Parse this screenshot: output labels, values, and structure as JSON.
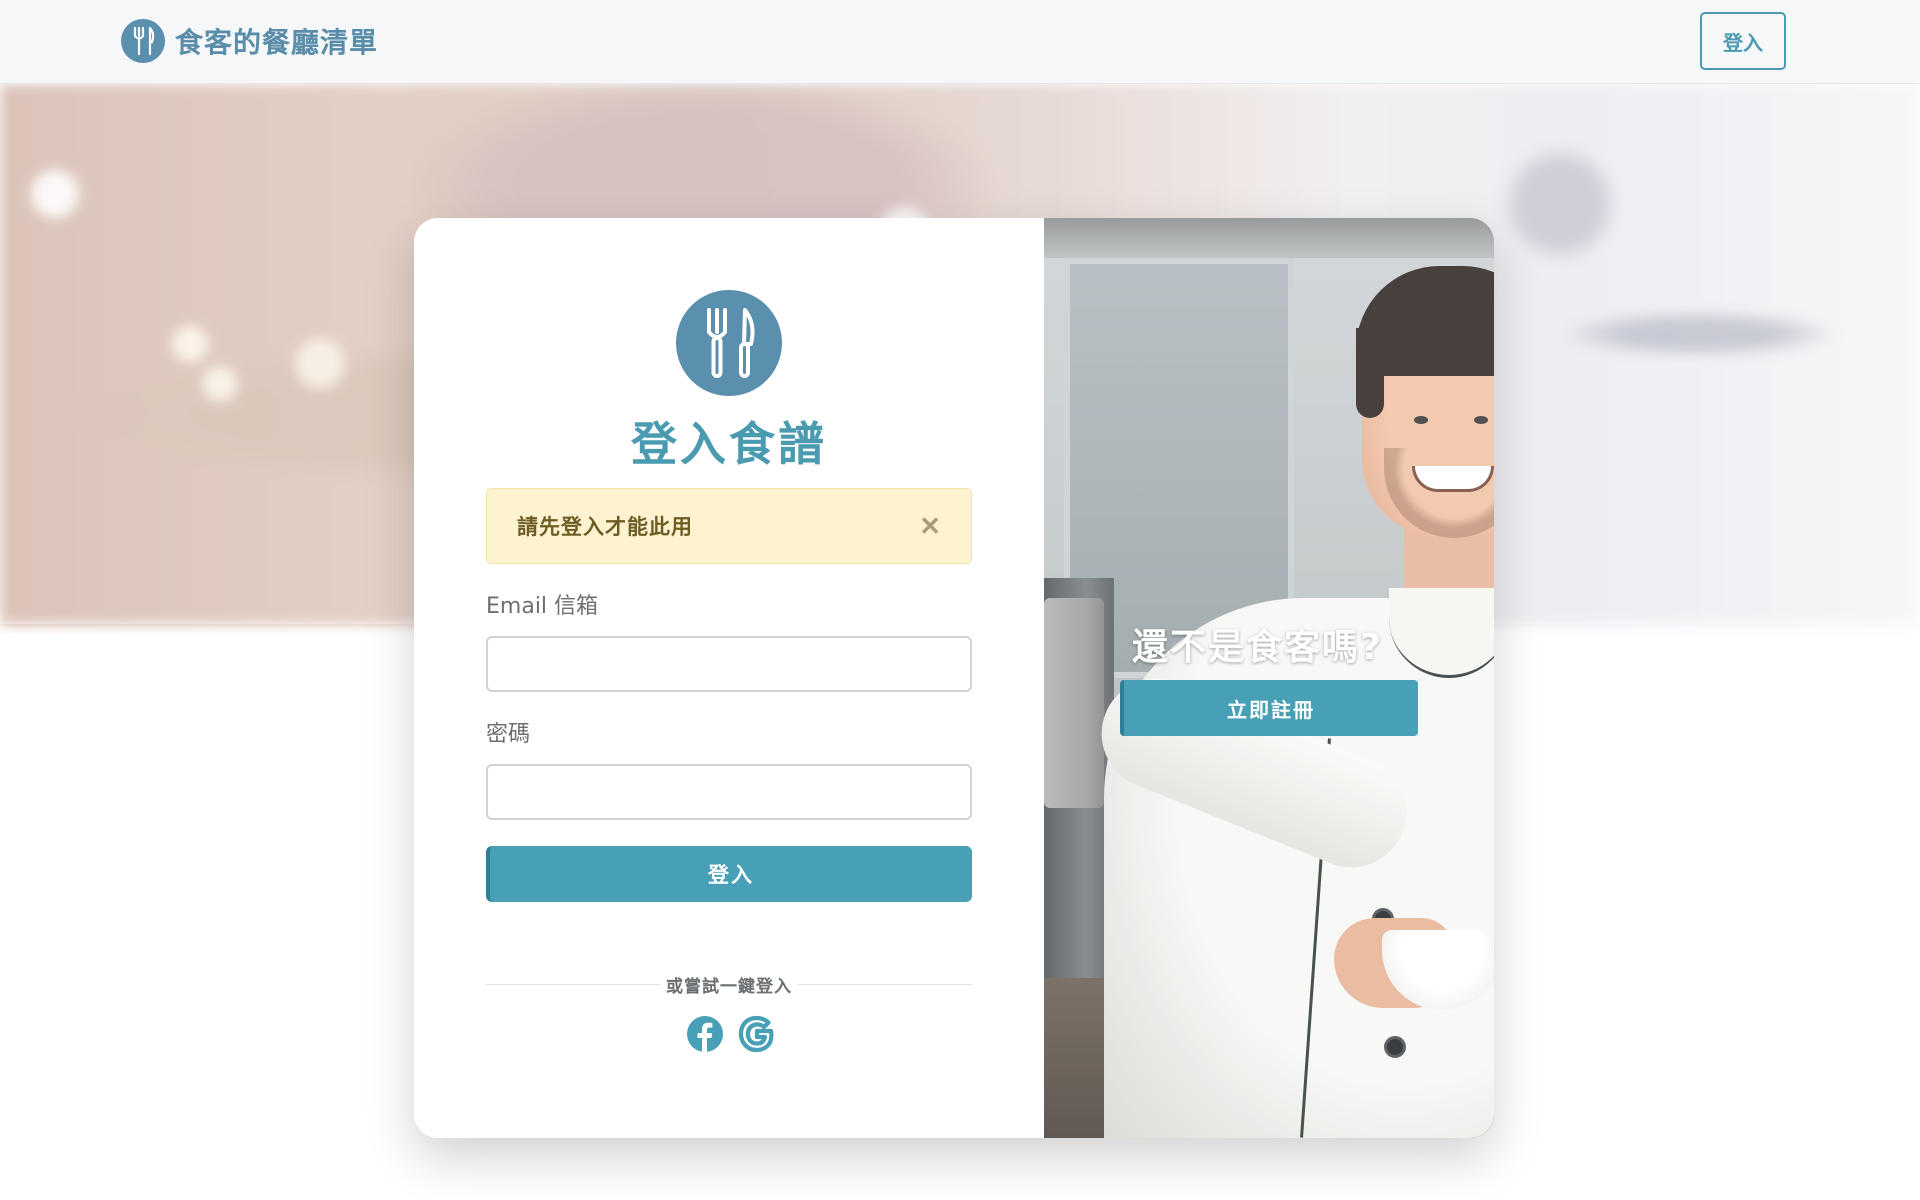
{
  "navbar": {
    "brand_icon": "fork-knife-icon",
    "brand_text": "食客的餐廳清單",
    "login_label": "登入"
  },
  "login_card": {
    "logo_icon": "fork-knife-icon",
    "title": "登入食譜",
    "alert": {
      "message": "請先登入才能此用",
      "close_icon": "close-icon",
      "close_glyph": "✕"
    },
    "email_label": "Email 信箱",
    "email_value": "",
    "password_label": "密碼",
    "password_value": "",
    "submit_label": "登入",
    "divider_text": "或嘗試一鍵登入",
    "social": [
      "facebook-icon",
      "google-icon"
    ]
  },
  "register_panel": {
    "prompt": "還不是食客嗎?",
    "button_label": "立即註冊"
  },
  "colors": {
    "accent": "#48a0b6",
    "brand": "#5b8fae",
    "alert_bg": "#fdf3d0",
    "alert_text": "#6d5d24"
  }
}
